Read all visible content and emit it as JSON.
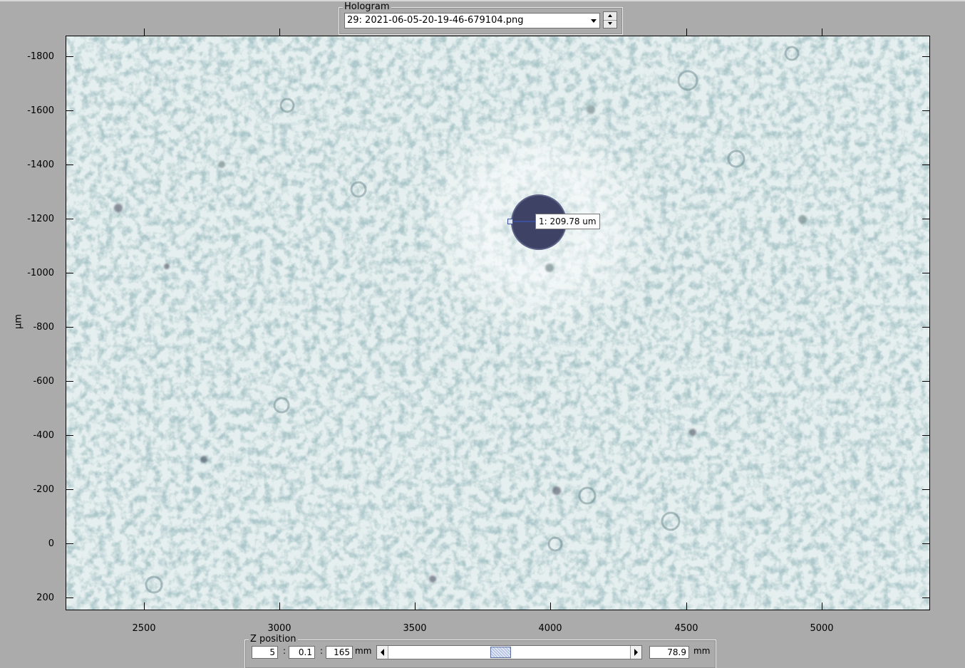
{
  "hologram": {
    "group_title": "Hologram",
    "selected_file": "29: 2021-06-05-20-19-46-679104.png"
  },
  "plot": {
    "y_label": "μm",
    "y_ticks": [
      "-1800",
      "-1600",
      "-1400",
      "-1200",
      "-1000",
      "-800",
      "-600",
      "-400",
      "-200",
      "0",
      "200"
    ],
    "x_ticks": [
      "2500",
      "3000",
      "3500",
      "4000",
      "4500",
      "5000"
    ],
    "measurement_label": "1: 209.78 um"
  },
  "z_position": {
    "group_title": "Z position",
    "start": "5",
    "step": "0.1",
    "end": "165",
    "range_unit": "mm",
    "separator": ":",
    "slider_fraction": 0.46,
    "current_value": "78.9",
    "value_unit": "mm"
  },
  "icons": {
    "dropdown": "chevron-down-icon",
    "spin_up": "arrow-up-icon",
    "spin_down": "arrow-down-icon",
    "slider_left": "arrow-left-icon",
    "slider_right": "arrow-right-icon"
  },
  "colors": {
    "background": "#ababab",
    "hologram_light": "#e9f1f1",
    "hologram_dark": "#6a8f95",
    "particle": "#3a3e5a",
    "measure_line": "#3b4f9a"
  }
}
